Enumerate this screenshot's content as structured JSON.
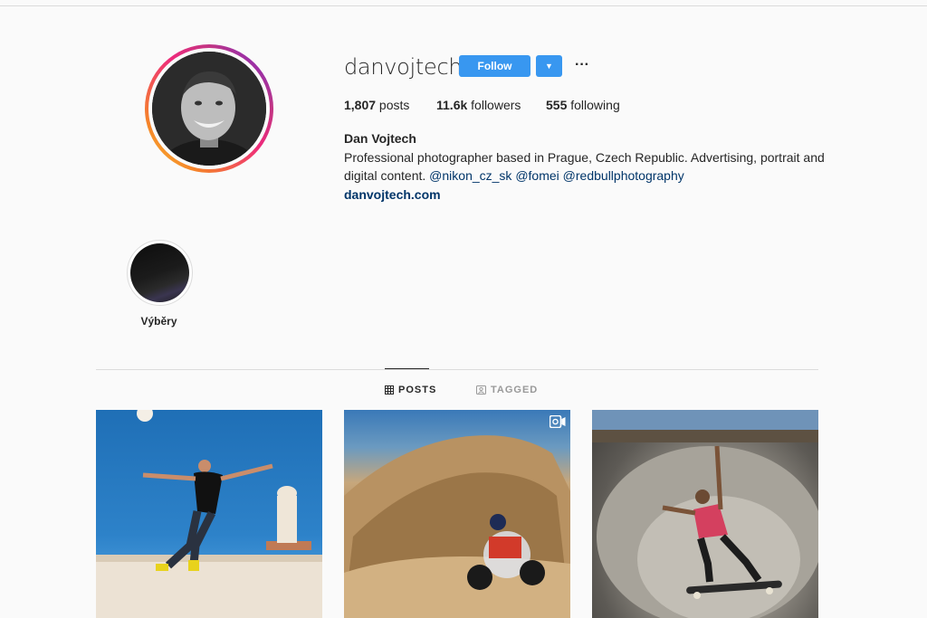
{
  "profile": {
    "username": "danvojtech",
    "follow_label": "Follow",
    "dropdown_glyph": "▼",
    "more_glyph": "···",
    "stats": {
      "posts_count": "1,807",
      "posts_label": " posts",
      "followers_count": "11.6k",
      "followers_label": " followers",
      "following_count": "555",
      "following_label": " following"
    },
    "full_name": "Dan Vojtech",
    "bio_text": "Professional photographer based in Prague, Czech Republic. Advertising, portrait and digital content. ",
    "mentions": [
      "@nikon_cz_sk",
      "@fomei",
      "@redbullphotography"
    ],
    "website": "danvojtech.com"
  },
  "highlights": [
    {
      "label": "Výběry"
    }
  ],
  "tabs": [
    {
      "label": "POSTS",
      "icon": "grid-icon",
      "active": true
    },
    {
      "label": "TAGGED",
      "icon": "tagged-icon",
      "active": false
    }
  ],
  "posts": [
    {
      "kind": "image",
      "subject": "dancer-jump"
    },
    {
      "kind": "video",
      "subject": "quad-dust"
    },
    {
      "kind": "image",
      "subject": "skateboard-bowl"
    }
  ],
  "colors": {
    "accent": "#3897f0",
    "link": "#003569",
    "text": "#262626",
    "border": "#dbdbdb",
    "background": "#fafafa"
  }
}
